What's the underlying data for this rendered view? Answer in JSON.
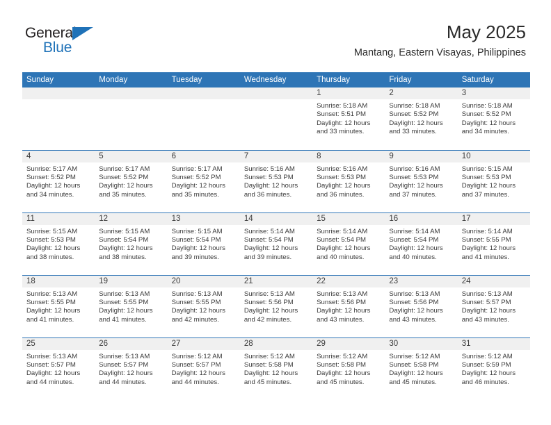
{
  "brand": {
    "name_top": "General",
    "name_bottom": "Blue",
    "triangle_color": "#1f72b8"
  },
  "header": {
    "title": "May 2025",
    "subtitle": "Mantang, Eastern Visayas, Philippines"
  },
  "colors": {
    "header_blue": "#2e75b6",
    "daynum_band": "#f0f0f0",
    "text": "#3a3a3a"
  },
  "weekdays": [
    "Sunday",
    "Monday",
    "Tuesday",
    "Wednesday",
    "Thursday",
    "Friday",
    "Saturday"
  ],
  "labels": {
    "sunrise_prefix": "Sunrise:",
    "sunset_prefix": "Sunset:",
    "daylight_prefix": "Daylight:"
  },
  "weeks": [
    [
      {
        "day": "",
        "empty": true
      },
      {
        "day": "",
        "empty": true
      },
      {
        "day": "",
        "empty": true
      },
      {
        "day": "",
        "empty": true
      },
      {
        "day": "1",
        "sunrise": "Sunrise: 5:18 AM",
        "sunset": "Sunset: 5:51 PM",
        "daylight_line1": "Daylight: 12 hours",
        "daylight_line2": "and 33 minutes."
      },
      {
        "day": "2",
        "sunrise": "Sunrise: 5:18 AM",
        "sunset": "Sunset: 5:52 PM",
        "daylight_line1": "Daylight: 12 hours",
        "daylight_line2": "and 33 minutes."
      },
      {
        "day": "3",
        "sunrise": "Sunrise: 5:18 AM",
        "sunset": "Sunset: 5:52 PM",
        "daylight_line1": "Daylight: 12 hours",
        "daylight_line2": "and 34 minutes."
      }
    ],
    [
      {
        "day": "4",
        "sunrise": "Sunrise: 5:17 AM",
        "sunset": "Sunset: 5:52 PM",
        "daylight_line1": "Daylight: 12 hours",
        "daylight_line2": "and 34 minutes."
      },
      {
        "day": "5",
        "sunrise": "Sunrise: 5:17 AM",
        "sunset": "Sunset: 5:52 PM",
        "daylight_line1": "Daylight: 12 hours",
        "daylight_line2": "and 35 minutes."
      },
      {
        "day": "6",
        "sunrise": "Sunrise: 5:17 AM",
        "sunset": "Sunset: 5:52 PM",
        "daylight_line1": "Daylight: 12 hours",
        "daylight_line2": "and 35 minutes."
      },
      {
        "day": "7",
        "sunrise": "Sunrise: 5:16 AM",
        "sunset": "Sunset: 5:53 PM",
        "daylight_line1": "Daylight: 12 hours",
        "daylight_line2": "and 36 minutes."
      },
      {
        "day": "8",
        "sunrise": "Sunrise: 5:16 AM",
        "sunset": "Sunset: 5:53 PM",
        "daylight_line1": "Daylight: 12 hours",
        "daylight_line2": "and 36 minutes."
      },
      {
        "day": "9",
        "sunrise": "Sunrise: 5:16 AM",
        "sunset": "Sunset: 5:53 PM",
        "daylight_line1": "Daylight: 12 hours",
        "daylight_line2": "and 37 minutes."
      },
      {
        "day": "10",
        "sunrise": "Sunrise: 5:15 AM",
        "sunset": "Sunset: 5:53 PM",
        "daylight_line1": "Daylight: 12 hours",
        "daylight_line2": "and 37 minutes."
      }
    ],
    [
      {
        "day": "11",
        "sunrise": "Sunrise: 5:15 AM",
        "sunset": "Sunset: 5:53 PM",
        "daylight_line1": "Daylight: 12 hours",
        "daylight_line2": "and 38 minutes."
      },
      {
        "day": "12",
        "sunrise": "Sunrise: 5:15 AM",
        "sunset": "Sunset: 5:54 PM",
        "daylight_line1": "Daylight: 12 hours",
        "daylight_line2": "and 38 minutes."
      },
      {
        "day": "13",
        "sunrise": "Sunrise: 5:15 AM",
        "sunset": "Sunset: 5:54 PM",
        "daylight_line1": "Daylight: 12 hours",
        "daylight_line2": "and 39 minutes."
      },
      {
        "day": "14",
        "sunrise": "Sunrise: 5:14 AM",
        "sunset": "Sunset: 5:54 PM",
        "daylight_line1": "Daylight: 12 hours",
        "daylight_line2": "and 39 minutes."
      },
      {
        "day": "15",
        "sunrise": "Sunrise: 5:14 AM",
        "sunset": "Sunset: 5:54 PM",
        "daylight_line1": "Daylight: 12 hours",
        "daylight_line2": "and 40 minutes."
      },
      {
        "day": "16",
        "sunrise": "Sunrise: 5:14 AM",
        "sunset": "Sunset: 5:54 PM",
        "daylight_line1": "Daylight: 12 hours",
        "daylight_line2": "and 40 minutes."
      },
      {
        "day": "17",
        "sunrise": "Sunrise: 5:14 AM",
        "sunset": "Sunset: 5:55 PM",
        "daylight_line1": "Daylight: 12 hours",
        "daylight_line2": "and 41 minutes."
      }
    ],
    [
      {
        "day": "18",
        "sunrise": "Sunrise: 5:13 AM",
        "sunset": "Sunset: 5:55 PM",
        "daylight_line1": "Daylight: 12 hours",
        "daylight_line2": "and 41 minutes."
      },
      {
        "day": "19",
        "sunrise": "Sunrise: 5:13 AM",
        "sunset": "Sunset: 5:55 PM",
        "daylight_line1": "Daylight: 12 hours",
        "daylight_line2": "and 41 minutes."
      },
      {
        "day": "20",
        "sunrise": "Sunrise: 5:13 AM",
        "sunset": "Sunset: 5:55 PM",
        "daylight_line1": "Daylight: 12 hours",
        "daylight_line2": "and 42 minutes."
      },
      {
        "day": "21",
        "sunrise": "Sunrise: 5:13 AM",
        "sunset": "Sunset: 5:56 PM",
        "daylight_line1": "Daylight: 12 hours",
        "daylight_line2": "and 42 minutes."
      },
      {
        "day": "22",
        "sunrise": "Sunrise: 5:13 AM",
        "sunset": "Sunset: 5:56 PM",
        "daylight_line1": "Daylight: 12 hours",
        "daylight_line2": "and 43 minutes."
      },
      {
        "day": "23",
        "sunrise": "Sunrise: 5:13 AM",
        "sunset": "Sunset: 5:56 PM",
        "daylight_line1": "Daylight: 12 hours",
        "daylight_line2": "and 43 minutes."
      },
      {
        "day": "24",
        "sunrise": "Sunrise: 5:13 AM",
        "sunset": "Sunset: 5:57 PM",
        "daylight_line1": "Daylight: 12 hours",
        "daylight_line2": "and 43 minutes."
      }
    ],
    [
      {
        "day": "25",
        "sunrise": "Sunrise: 5:13 AM",
        "sunset": "Sunset: 5:57 PM",
        "daylight_line1": "Daylight: 12 hours",
        "daylight_line2": "and 44 minutes."
      },
      {
        "day": "26",
        "sunrise": "Sunrise: 5:13 AM",
        "sunset": "Sunset: 5:57 PM",
        "daylight_line1": "Daylight: 12 hours",
        "daylight_line2": "and 44 minutes."
      },
      {
        "day": "27",
        "sunrise": "Sunrise: 5:12 AM",
        "sunset": "Sunset: 5:57 PM",
        "daylight_line1": "Daylight: 12 hours",
        "daylight_line2": "and 44 minutes."
      },
      {
        "day": "28",
        "sunrise": "Sunrise: 5:12 AM",
        "sunset": "Sunset: 5:58 PM",
        "daylight_line1": "Daylight: 12 hours",
        "daylight_line2": "and 45 minutes."
      },
      {
        "day": "29",
        "sunrise": "Sunrise: 5:12 AM",
        "sunset": "Sunset: 5:58 PM",
        "daylight_line1": "Daylight: 12 hours",
        "daylight_line2": "and 45 minutes."
      },
      {
        "day": "30",
        "sunrise": "Sunrise: 5:12 AM",
        "sunset": "Sunset: 5:58 PM",
        "daylight_line1": "Daylight: 12 hours",
        "daylight_line2": "and 45 minutes."
      },
      {
        "day": "31",
        "sunrise": "Sunrise: 5:12 AM",
        "sunset": "Sunset: 5:59 PM",
        "daylight_line1": "Daylight: 12 hours",
        "daylight_line2": "and 46 minutes."
      }
    ]
  ]
}
